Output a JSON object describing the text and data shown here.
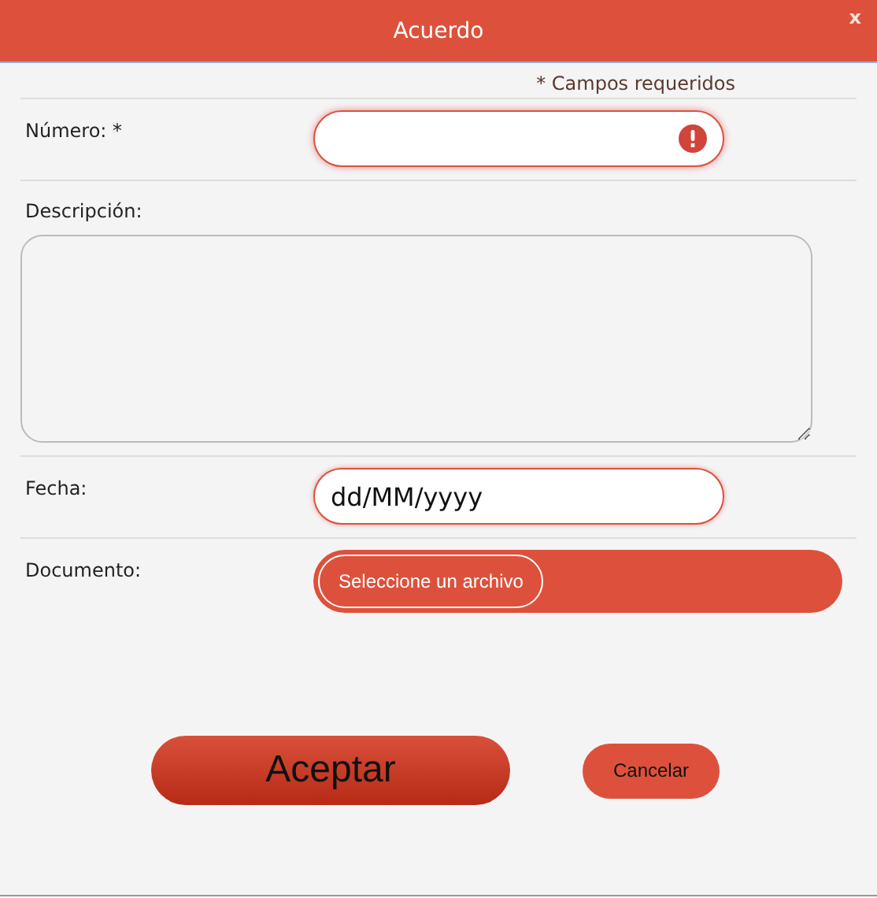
{
  "window": {
    "title": "Acuerdo",
    "close": "x"
  },
  "required_note": "* Campos requeridos",
  "fields": [
    {
      "kind": "text",
      "label": "Número: *",
      "invalid": true
    },
    {
      "kind": "textarea",
      "label": "Descripción:"
    },
    {
      "kind": "date",
      "label": "Fecha:",
      "value": "dd/MM/yyyy",
      "invalid": false
    },
    {
      "kind": "file",
      "label": "Documento:",
      "button": "Seleccione un archivo"
    }
  ],
  "buttons": [
    {
      "label": "Aceptar",
      "kind": "primary"
    },
    {
      "label": "Cancelar",
      "kind": "secondary"
    }
  ]
}
